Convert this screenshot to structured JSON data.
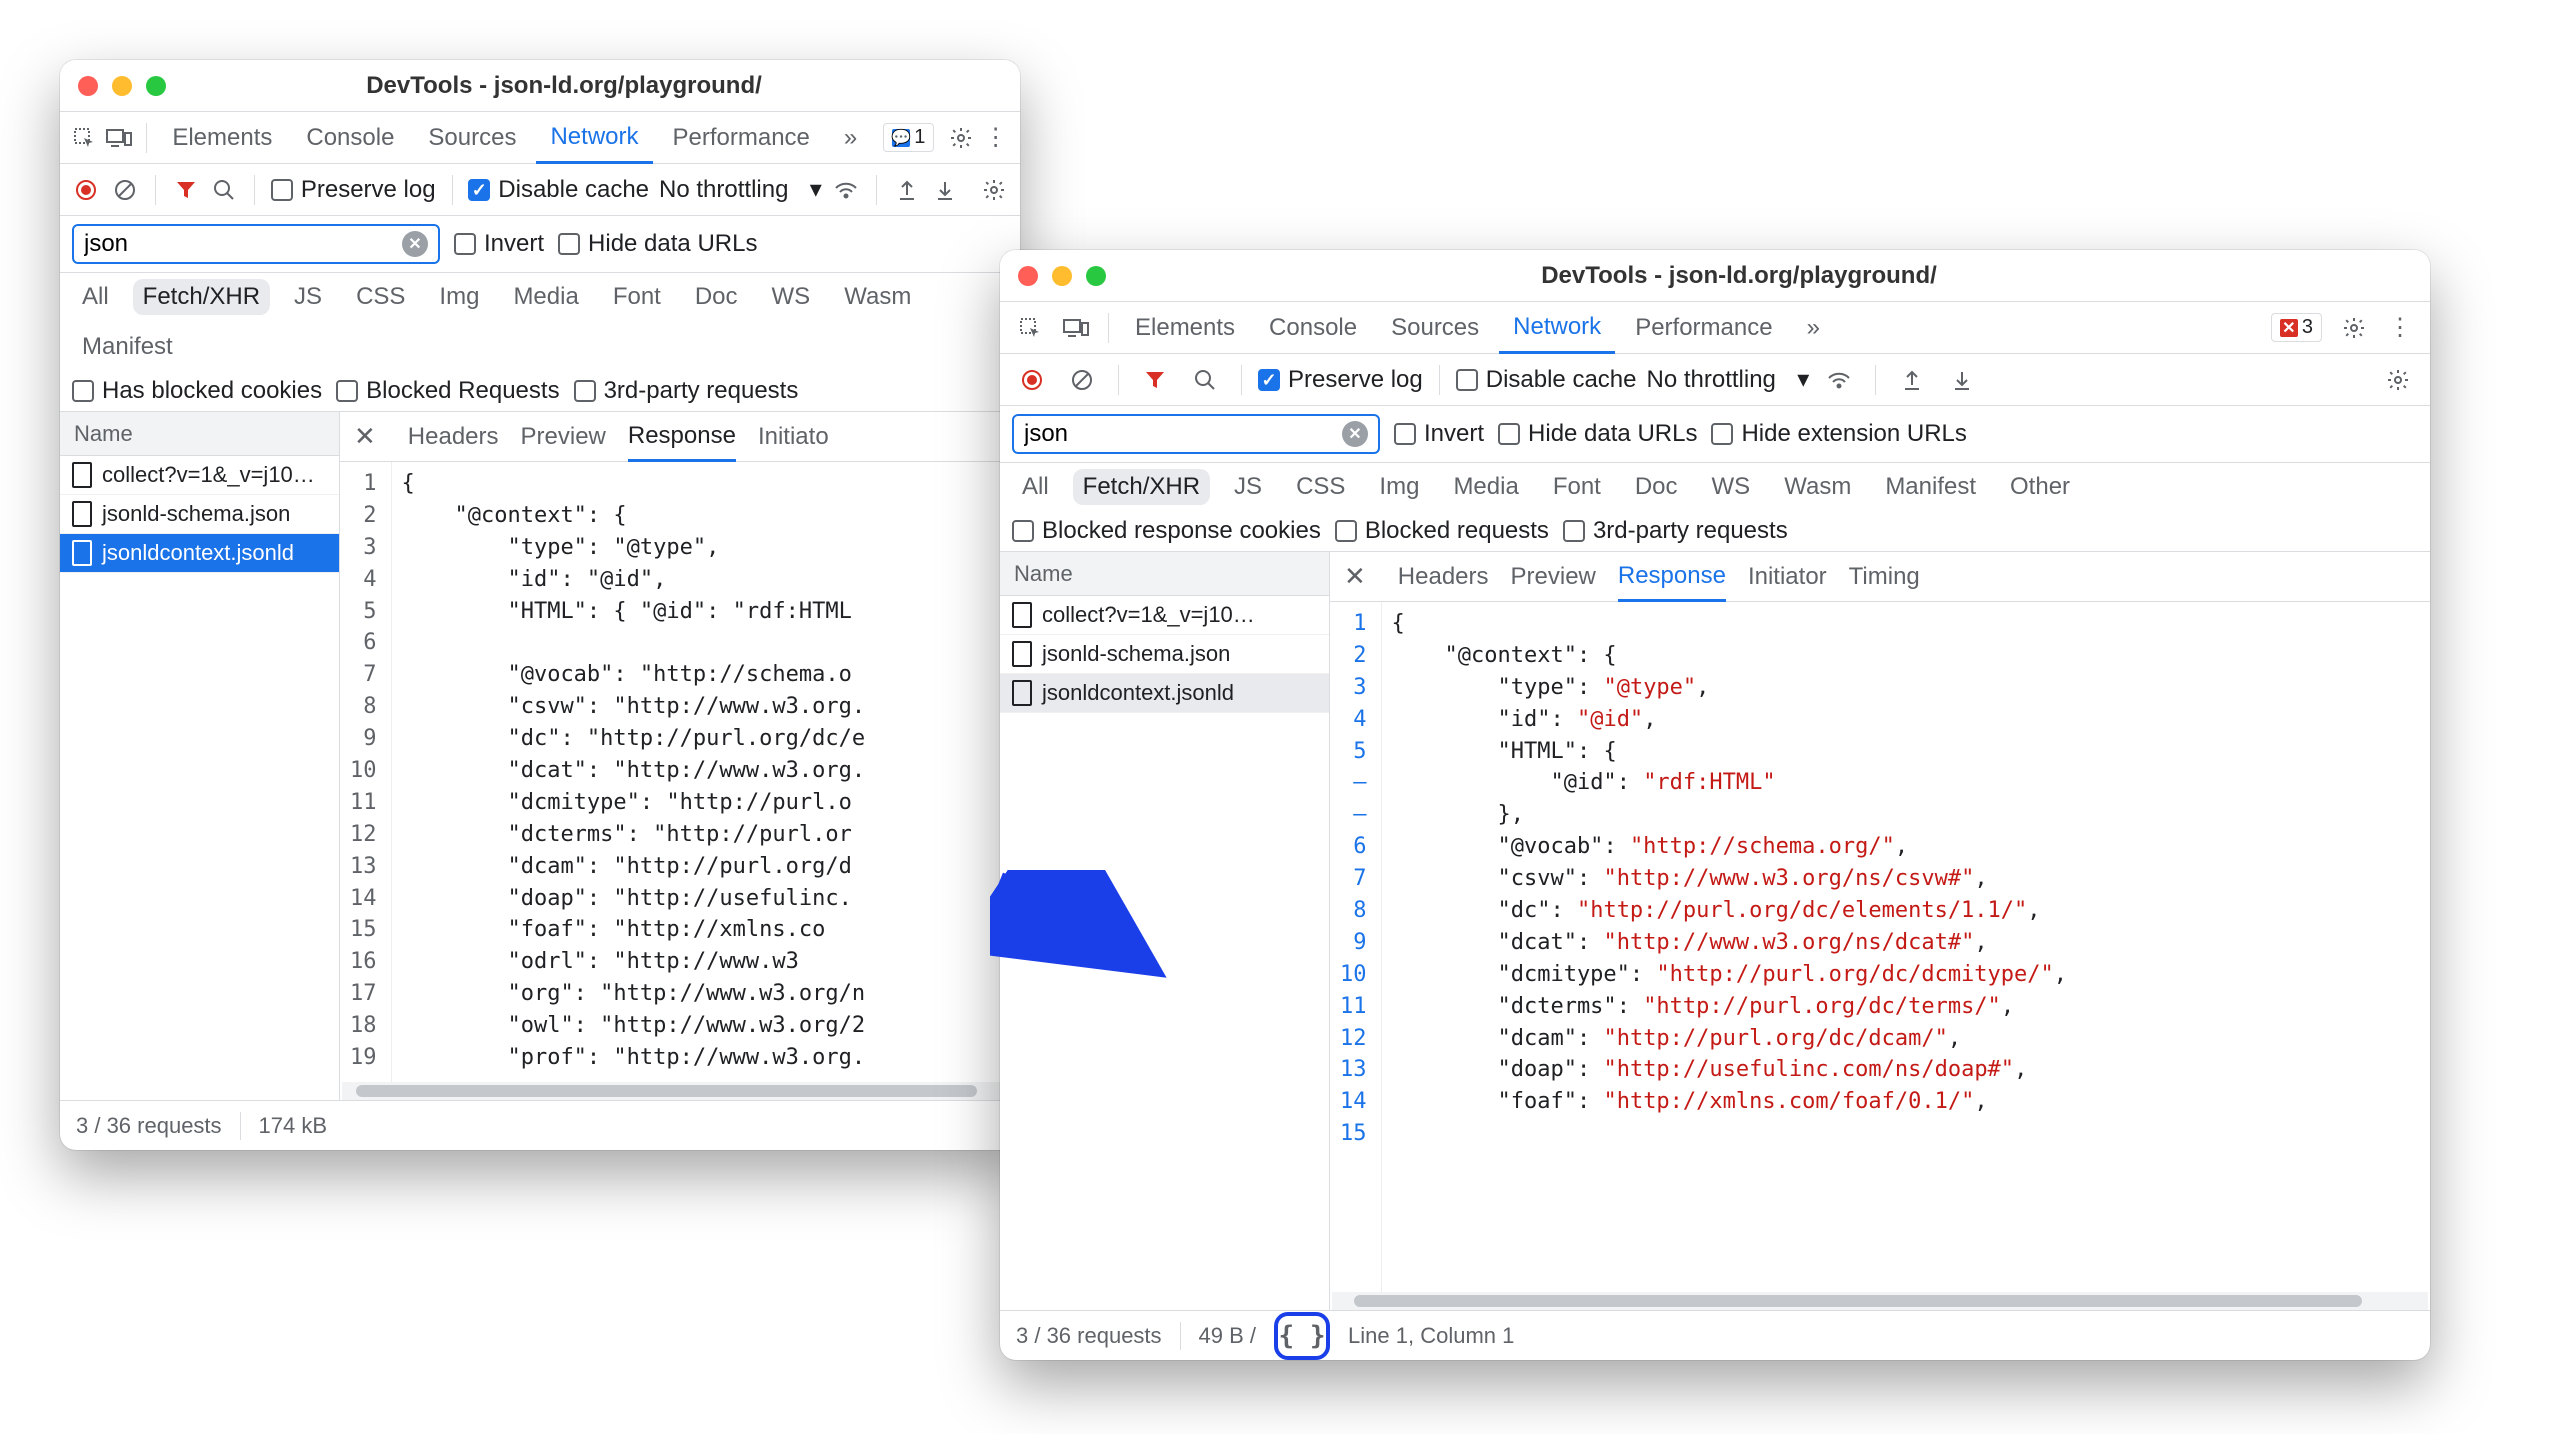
{
  "shared": {
    "window_title": "DevTools - json-ld.org/playground/",
    "main_tabs": [
      "Elements",
      "Console",
      "Sources",
      "Network",
      "Performance"
    ],
    "active_tab": "Network",
    "more": "»",
    "filter_value": "json",
    "invert": "Invert",
    "hide_data_urls": "Hide data URLs",
    "hide_ext_urls": "Hide extension URLs",
    "preserve_log": "Preserve log",
    "disable_cache": "Disable cache",
    "no_throttling": "No throttling",
    "type_chips": [
      "All",
      "Fetch/XHR",
      "JS",
      "CSS",
      "Img",
      "Media",
      "Font",
      "Doc",
      "WS",
      "Wasm",
      "Manifest"
    ],
    "type_chips_w2_extra": "Other",
    "name_header": "Name",
    "sub_tabs": [
      "Headers",
      "Preview",
      "Response",
      "Initiator",
      "Timing"
    ],
    "active_sub": "Response",
    "initiator_trunc": "Initiato",
    "requests": [
      {
        "label": "collect?v=1&_v=j10…"
      },
      {
        "label": "jsonld-schema.json"
      },
      {
        "label": "jsonldcontext.jsonld"
      }
    ]
  },
  "w1": {
    "issues_count": "1",
    "check_labels": {
      "has_blocked": "Has blocked cookies",
      "blocked_req": "Blocked Requests",
      "third_party": "3rd-party requests"
    },
    "status": {
      "requests": "3 / 36 requests",
      "size": "174 kB"
    },
    "code": {
      "gutter": [
        "1",
        "2",
        "3",
        "4",
        "5",
        "6",
        "7",
        "8",
        "9",
        "10",
        "11",
        "12",
        "13",
        "14",
        "15",
        "16",
        "17",
        "18",
        "19"
      ],
      "plain": "{\n    \"@context\": {\n        \"type\": \"@type\",\n        \"id\": \"@id\",\n        \"HTML\": { \"@id\": \"rdf:HTML\n\n        \"@vocab\": \"http://schema.o\n        \"csvw\": \"http://www.w3.org.\n        \"dc\": \"http://purl.org/dc/e\n        \"dcat\": \"http://www.w3.org.\n        \"dcmitype\": \"http://purl.o\n        \"dcterms\": \"http://purl.or\n        \"dcam\": \"http://purl.org/d\n        \"doap\": \"http://usefulinc.\n        \"foaf\": \"http://xmlns.co\n        \"odrl\": \"http://www.w3\n        \"org\": \"http://www.w3.org/n\n        \"owl\": \"http://www.w3.org/2\n        \"prof\": \"http://www.w3.org."
    }
  },
  "w2": {
    "errors_count": "3",
    "check_labels": {
      "blocked_cookies": "Blocked response cookies",
      "blocked_req": "Blocked requests",
      "third_party": "3rd-party requests"
    },
    "status": {
      "requests": "3 / 36 requests",
      "size": "49 B /",
      "cursor": "Line 1, Column 1"
    },
    "code": {
      "gutter": [
        "1",
        "2",
        "3",
        "4",
        "5",
        "–",
        "–",
        "6",
        "7",
        "8",
        "9",
        "10",
        "11",
        "12",
        "13",
        "14",
        "15"
      ],
      "lines": [
        [
          [
            "plain",
            "{"
          ]
        ],
        [
          [
            "plain",
            "    "
          ],
          [
            "key",
            "\"@context\""
          ],
          [
            "plain",
            ": {"
          ]
        ],
        [
          [
            "plain",
            "        "
          ],
          [
            "key",
            "\"type\""
          ],
          [
            "plain",
            ": "
          ],
          [
            "str",
            "\"@type\""
          ],
          [
            "plain",
            ","
          ]
        ],
        [
          [
            "plain",
            "        "
          ],
          [
            "key",
            "\"id\""
          ],
          [
            "plain",
            ": "
          ],
          [
            "str",
            "\"@id\""
          ],
          [
            "plain",
            ","
          ]
        ],
        [
          [
            "plain",
            "        "
          ],
          [
            "key",
            "\"HTML\""
          ],
          [
            "plain",
            ": {"
          ]
        ],
        [
          [
            "plain",
            "            "
          ],
          [
            "key",
            "\"@id\""
          ],
          [
            "plain",
            ": "
          ],
          [
            "str",
            "\"rdf:HTML\""
          ]
        ],
        [
          [
            "plain",
            "        },"
          ]
        ],
        [
          [
            "plain",
            "        "
          ],
          [
            "key",
            "\"@vocab\""
          ],
          [
            "plain",
            ": "
          ],
          [
            "str",
            "\"http://schema.org/\""
          ],
          [
            "plain",
            ","
          ]
        ],
        [
          [
            "plain",
            "        "
          ],
          [
            "key",
            "\"csvw\""
          ],
          [
            "plain",
            ": "
          ],
          [
            "str",
            "\"http://www.w3.org/ns/csvw#\""
          ],
          [
            "plain",
            ","
          ]
        ],
        [
          [
            "plain",
            "        "
          ],
          [
            "key",
            "\"dc\""
          ],
          [
            "plain",
            ": "
          ],
          [
            "str",
            "\"http://purl.org/dc/elements/1.1/\""
          ],
          [
            "plain",
            ","
          ]
        ],
        [
          [
            "plain",
            "        "
          ],
          [
            "key",
            "\"dcat\""
          ],
          [
            "plain",
            ": "
          ],
          [
            "str",
            "\"http://www.w3.org/ns/dcat#\""
          ],
          [
            "plain",
            ","
          ]
        ],
        [
          [
            "plain",
            "        "
          ],
          [
            "key",
            "\"dcmitype\""
          ],
          [
            "plain",
            ": "
          ],
          [
            "str",
            "\"http://purl.org/dc/dcmitype/\""
          ],
          [
            "plain",
            ","
          ]
        ],
        [
          [
            "plain",
            "        "
          ],
          [
            "key",
            "\"dcterms\""
          ],
          [
            "plain",
            ": "
          ],
          [
            "str",
            "\"http://purl.org/dc/terms/\""
          ],
          [
            "plain",
            ","
          ]
        ],
        [
          [
            "plain",
            "        "
          ],
          [
            "key",
            "\"dcam\""
          ],
          [
            "plain",
            ": "
          ],
          [
            "str",
            "\"http://purl.org/dc/dcam/\""
          ],
          [
            "plain",
            ","
          ]
        ],
        [
          [
            "plain",
            "        "
          ],
          [
            "key",
            "\"doap\""
          ],
          [
            "plain",
            ": "
          ],
          [
            "str",
            "\"http://usefulinc.com/ns/doap#\""
          ],
          [
            "plain",
            ","
          ]
        ],
        [
          [
            "plain",
            "        "
          ],
          [
            "key",
            "\"foaf\""
          ],
          [
            "plain",
            ": "
          ],
          [
            "str",
            "\"http://xmlns.com/foaf/0.1/\""
          ],
          [
            "plain",
            ","
          ]
        ]
      ]
    }
  }
}
